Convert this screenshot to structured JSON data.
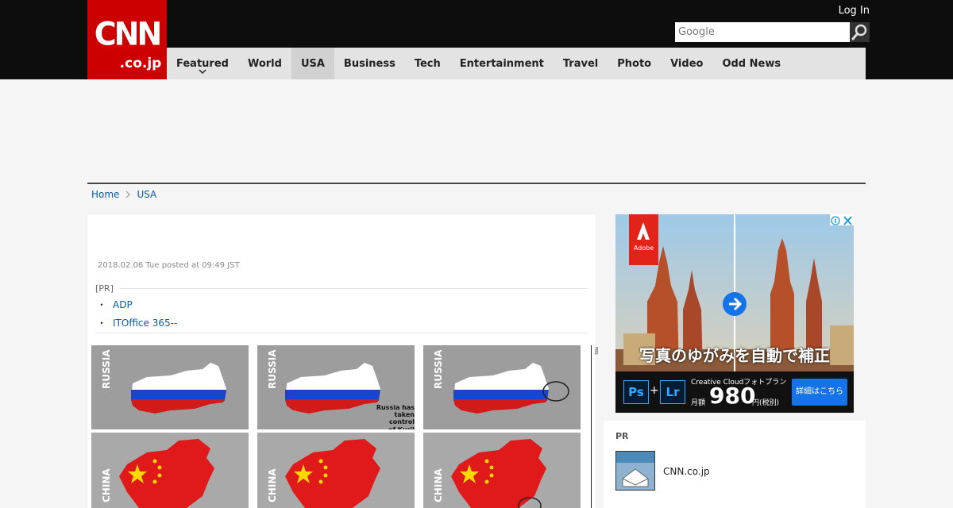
{
  "header": {
    "logo": {
      "main": "CNN",
      "sub": ".co.jp"
    },
    "login_label": "Log In",
    "search": {
      "placeholder": "Google",
      "button_icon": "search-icon"
    }
  },
  "nav": {
    "items": [
      {
        "label": "Featured",
        "has_dropdown": true
      },
      {
        "label": "World"
      },
      {
        "label": "USA",
        "active": true
      },
      {
        "label": "Business"
      },
      {
        "label": "Tech"
      },
      {
        "label": "Entertainment"
      },
      {
        "label": "Travel"
      },
      {
        "label": "Photo"
      },
      {
        "label": "Video"
      },
      {
        "label": "Odd News"
      }
    ]
  },
  "breadcrumb": {
    "home": "Home",
    "current": "USA"
  },
  "article": {
    "posted": "2018.02.06 Tue posted at 09:49 JST",
    "pr_heading": "[PR]",
    "pr_links": [
      "ADP",
      "ITOffice 365--"
    ],
    "image": {
      "tiles": [
        {
          "label": "RUSSIA",
          "caption": ""
        },
        {
          "label": "RUSSIA",
          "caption": "Russia has\ntaken control\nof Kuril Islands"
        },
        {
          "label": "RUSSIA",
          "caption": ""
        },
        {
          "label": "CHINA",
          "caption": ""
        },
        {
          "label": "CHINA",
          "caption": ""
        },
        {
          "label": "CHINA",
          "caption": ""
        }
      ],
      "strip_text": "FRS"
    }
  },
  "side_ad": {
    "brand": "Adobe",
    "headline_jp": "写真のゆがみを自動で補正",
    "product": "Creative Cloudフォトプラン",
    "price_prefix": "月額",
    "price": "980",
    "price_suffix": "円(税別)",
    "cta": "詳細はこちら",
    "app_icons": [
      "Ps",
      "Lr"
    ],
    "plus": "+"
  },
  "pr_box": {
    "heading": "PR",
    "item": "CNN.co.jp"
  },
  "colors": {
    "brand_red": "#cc0000",
    "link_blue": "#0b5aa8",
    "topbar": "#0d0d0d",
    "nav_bg": "#e3e3e3"
  }
}
